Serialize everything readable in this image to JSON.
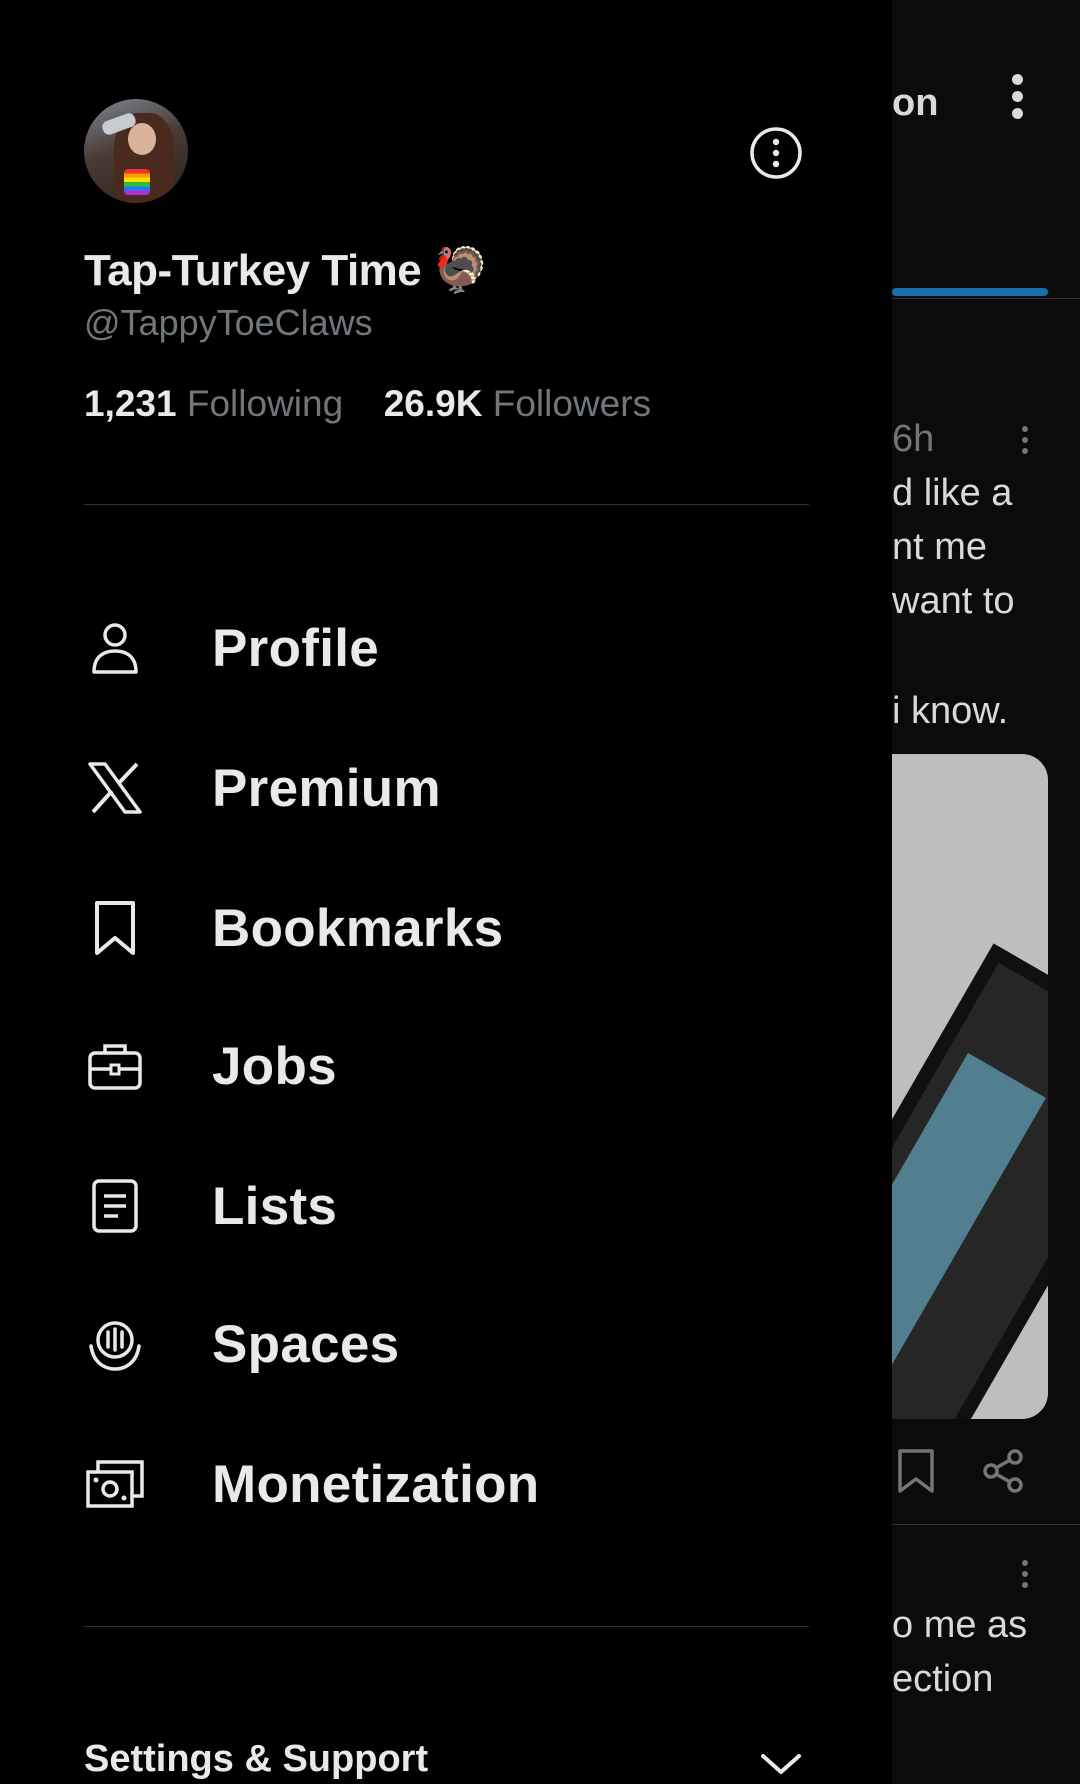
{
  "profile": {
    "display_name": "Tap-Turkey Time 🦃",
    "handle": "@TappyToeClaws",
    "following_count": "1,231",
    "following_label": "Following",
    "followers_count": "26.9K",
    "followers_label": "Followers"
  },
  "menu": [
    {
      "label": "Profile",
      "icon": "person-icon"
    },
    {
      "label": "Premium",
      "icon": "x-logo-icon"
    },
    {
      "label": "Bookmarks",
      "icon": "bookmark-icon"
    },
    {
      "label": "Jobs",
      "icon": "briefcase-icon"
    },
    {
      "label": "Lists",
      "icon": "list-icon"
    },
    {
      "label": "Spaces",
      "icon": "spaces-icon"
    },
    {
      "label": "Monetization",
      "icon": "money-icon"
    }
  ],
  "settings_support": "Settings & Support",
  "background_feed": {
    "header_fragment": "on",
    "tweet_time": "6h",
    "tweet_lines": [
      "d like a",
      "nt me",
      "want to",
      "i know."
    ],
    "next_tweet_lines": [
      "o me as",
      "ection"
    ]
  },
  "colors": {
    "background": "#000000",
    "text_primary": "#e7e9ea",
    "text_secondary": "#71767b",
    "divider": "#2f3336",
    "accent": "#1d9bf0"
  }
}
